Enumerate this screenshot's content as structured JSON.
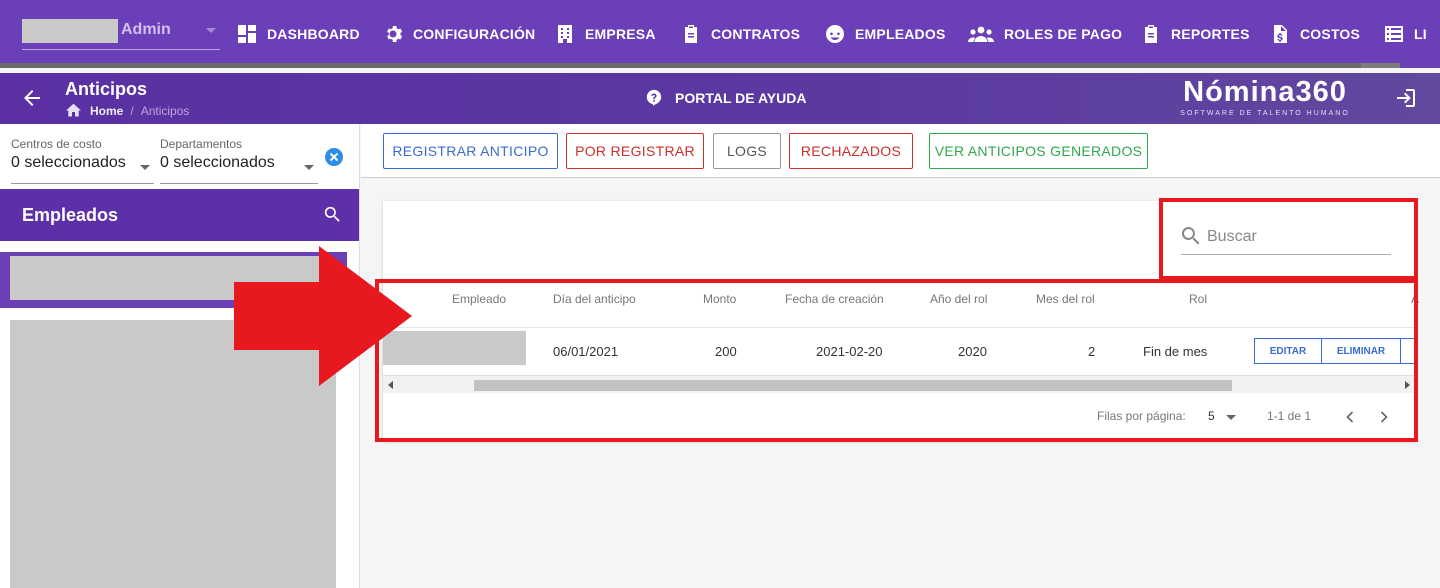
{
  "topnav": {
    "user_name": "Admin",
    "progress": 0.972,
    "items": [
      {
        "label": "DASHBOARD",
        "icon": "dashboard-icon"
      },
      {
        "label": "CONFIGURACIÓN",
        "icon": "gear-icon"
      },
      {
        "label": "EMPRESA",
        "icon": "building-icon"
      },
      {
        "label": "CONTRATOS",
        "icon": "clipboard-icon"
      },
      {
        "label": "EMPLEADOS",
        "icon": "face-icon"
      },
      {
        "label": "ROLES DE PAGO",
        "icon": "group-icon"
      },
      {
        "label": "REPORTES",
        "icon": "clipboard-icon"
      },
      {
        "label": "COSTOS",
        "icon": "dollar-file-icon"
      },
      {
        "label": "LI",
        "icon": "list-icon"
      }
    ]
  },
  "subheader": {
    "title": "Anticipos",
    "breadcrumb": {
      "home": "Home",
      "separator": "/",
      "current": "Anticipos"
    },
    "help": "PORTAL DE AYUDA",
    "brand_name": "Nómina360",
    "brand_tagline": "SOFTWARE DE TALENTO HUMANO"
  },
  "filters": {
    "cost_centers": {
      "label": "Centros de costo",
      "value": "0 seleccionados"
    },
    "departments": {
      "label": "Departamentos",
      "value": "0 seleccionados"
    }
  },
  "employees_panel": {
    "title": "Empleados"
  },
  "actions": {
    "register": "REGISTRAR ANTICIPO",
    "pending": "POR REGISTRAR",
    "logs": "LOGS",
    "rejected": "RECHAZADOS",
    "generated": "VER ANTICIPOS GENERADOS"
  },
  "table": {
    "search_placeholder": "Buscar",
    "columns": [
      "Empleado",
      "Día del anticipo",
      "Monto",
      "Fecha de creación",
      "Año del rol",
      "Mes del rol",
      "Rol",
      "A"
    ],
    "rows": [
      {
        "day": "06/01/2021",
        "amount": "200",
        "created": "2021-02-20",
        "year": "2020",
        "month": "2",
        "rol": "Fin de mes"
      }
    ],
    "row_actions": {
      "edit": "EDITAR",
      "delete": "ELIMINAR"
    },
    "pagination": {
      "rows_per_page_label": "Filas por página:",
      "rows_per_page": "5",
      "range": "1-1 de 1"
    }
  },
  "colors": {
    "primary": "#6a3fb8",
    "annotation": "#e8181f",
    "blue": "#3a6bd1",
    "red": "#d0302a",
    "green": "#2fa84f"
  }
}
